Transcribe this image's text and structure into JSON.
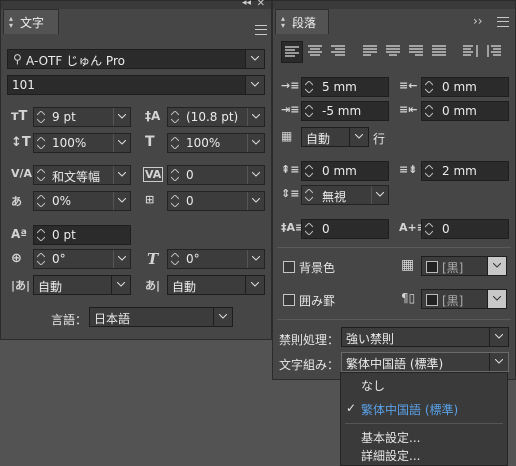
{
  "panel_left": {
    "tab_title": "文字",
    "font_family": "A-OTF じゅん Pro",
    "font_style": "101",
    "font_size": "9 pt",
    "leading": "(10.8 pt)",
    "vertical_scale": "100%",
    "horizontal_scale": "100%",
    "kerning": "和文等幅",
    "tracking": "0",
    "tsume": "0%",
    "mojikumi_spacing": "0",
    "baseline_shift": "0 pt",
    "rotation": "0°",
    "skew": "0°",
    "aki_before": "自動",
    "aki_after": "自動",
    "language_label": "言語：",
    "language_value": "日本語"
  },
  "panel_right": {
    "tab_title": "段落",
    "expand_glyph": "››",
    "left_indent": "5 mm",
    "right_indent": "0 mm",
    "first_line_indent": "-5 mm",
    "last_line_right_indent": "0 mm",
    "grid_align": "自動",
    "grid_align_suffix": "行",
    "space_before": "0 mm",
    "space_after": "2 mm",
    "align_to_grid": "無視",
    "drop_cap_lines": "0",
    "drop_cap_chars": "0",
    "shading_label": "背景色",
    "shading_color": "[黒]",
    "border_label": "囲み罫",
    "border_color": "[黒]",
    "kinsoku_label": "禁則処理：",
    "kinsoku_value": "強い禁則",
    "mojikumi_label": "文字組み：",
    "mojikumi_value": "繁体中国語 (標準)"
  },
  "dropdown_menu": {
    "items": [
      "なし",
      "繁体中国語 (標準)",
      "基本設定...",
      "詳細設定..."
    ],
    "selected_index": 1,
    "selected_color": "#5aa0e8"
  },
  "colors": {
    "panel_bg": "#464646",
    "field_bg": "#2b2b2b",
    "swatch_black": "#222222"
  }
}
